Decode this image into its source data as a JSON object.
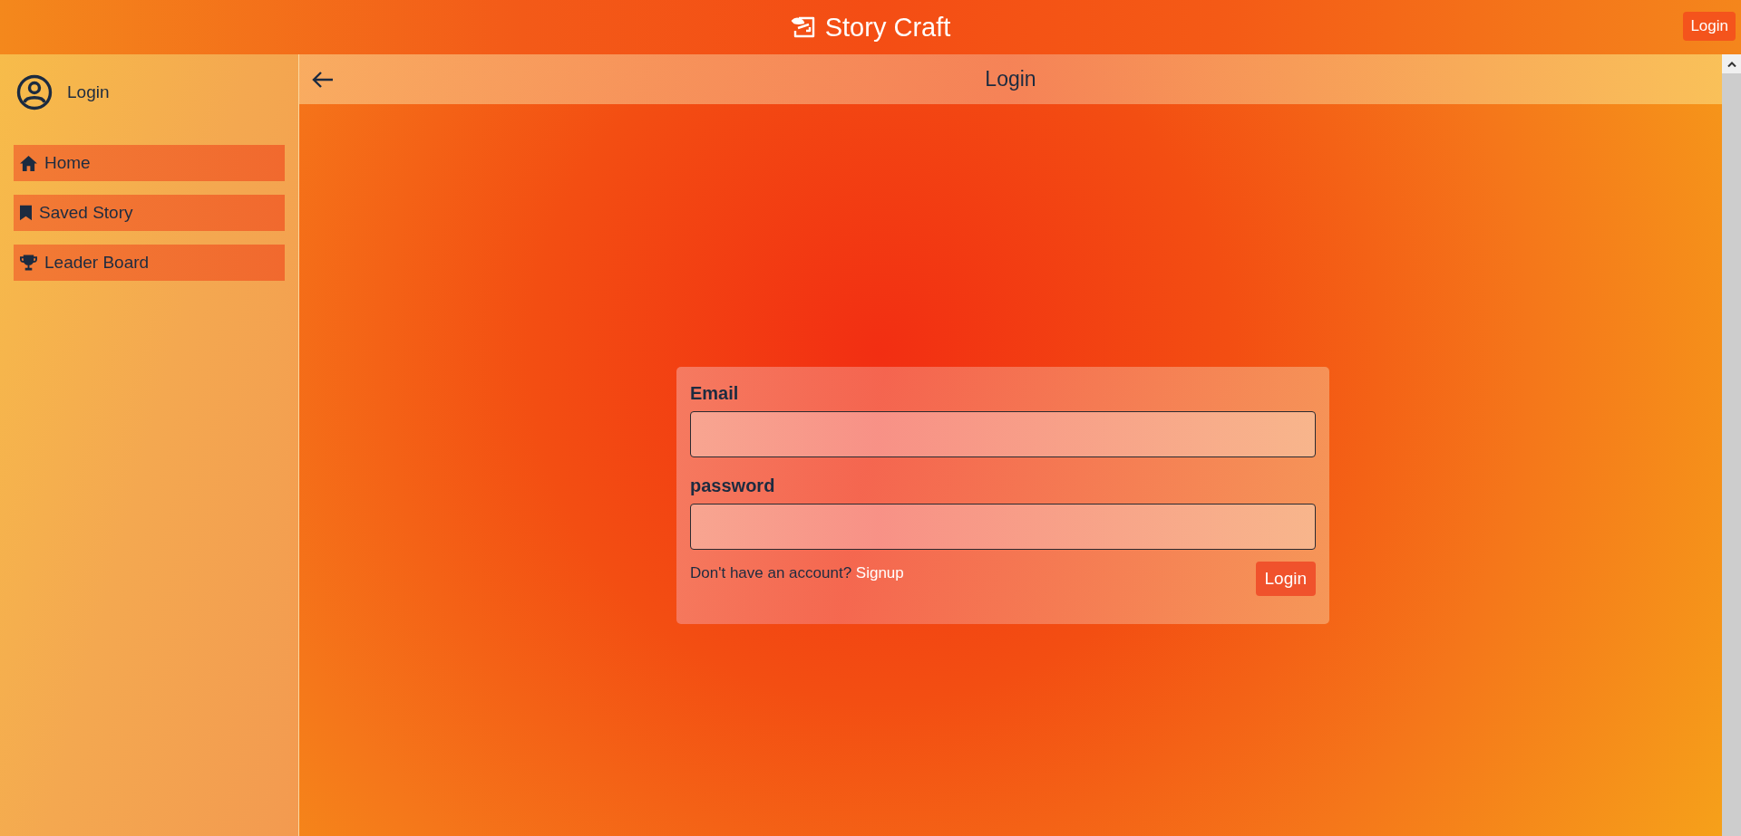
{
  "header": {
    "title": "Story Craft",
    "login_button": "Login"
  },
  "sidebar": {
    "user_label": "Login",
    "items": [
      {
        "kind": "home",
        "label": "Home"
      },
      {
        "kind": "bookmark",
        "label": "Saved Story"
      },
      {
        "kind": "trophy",
        "label": "Leader Board"
      }
    ]
  },
  "page": {
    "title": "Login"
  },
  "form": {
    "fields": [
      {
        "label": "Email"
      },
      {
        "label": "password"
      }
    ],
    "prompt": "Don't have an account?",
    "link": "Signup",
    "submit": "Login"
  }
}
